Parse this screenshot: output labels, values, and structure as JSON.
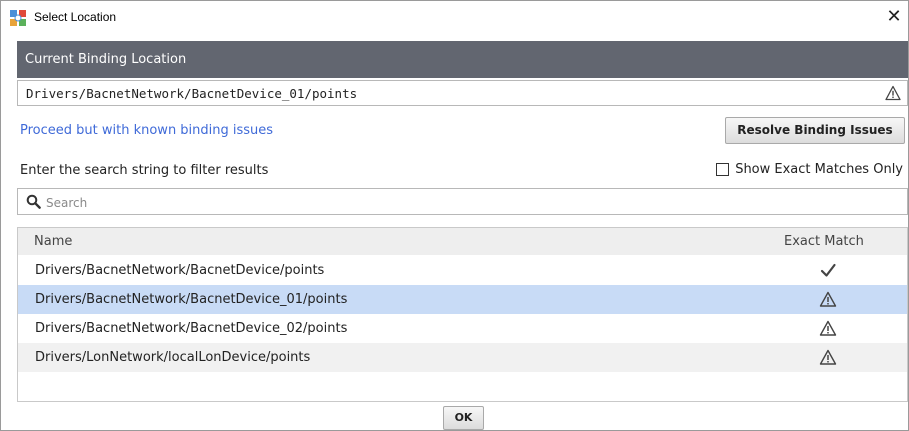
{
  "window": {
    "title": "Select Location",
    "close_glyph": "✕"
  },
  "binding": {
    "header": "Current Binding Location",
    "value": "Drivers/BacnetNetwork/BacnetDevice_01/points",
    "status_icon": "warning-triangle-icon"
  },
  "actions": {
    "proceed_link": "Proceed but with known binding issues",
    "resolve_button": "Resolve Binding Issues"
  },
  "filter": {
    "label": "Enter the search string to filter results",
    "exact_only_label": "Show Exact Matches Only",
    "exact_only_checked": false,
    "search_placeholder": "Search",
    "search_value": ""
  },
  "table": {
    "columns": [
      "Name",
      "Exact Match"
    ],
    "rows": [
      {
        "name": "Drivers/BacnetNetwork/BacnetDevice/points",
        "match": "check",
        "selected": false
      },
      {
        "name": "Drivers/BacnetNetwork/BacnetDevice_01/points",
        "match": "warning",
        "selected": true
      },
      {
        "name": "Drivers/BacnetNetwork/BacnetDevice_02/points",
        "match": "warning",
        "selected": false
      },
      {
        "name": "Drivers/LonNetwork/localLonDevice/points",
        "match": "warning",
        "selected": false
      }
    ]
  },
  "footer": {
    "ok_label": "OK"
  },
  "colors": {
    "header_bg": "#626670",
    "link": "#3f6ad8",
    "selected_row": "#c8dbf6",
    "alt_row": "#f1f1f1"
  }
}
